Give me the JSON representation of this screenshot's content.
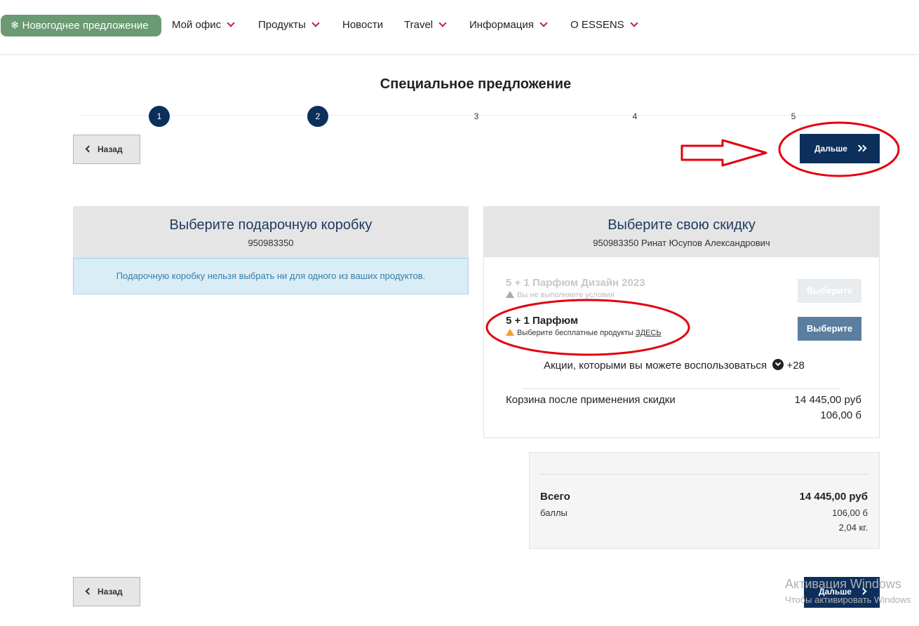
{
  "nav": {
    "promo_label": "Новогоднее предложение",
    "items": [
      "Мой офис",
      "Продукты",
      "Новости",
      "Travel",
      "Информация",
      "O ESSENS"
    ]
  },
  "page": {
    "title": "Специальное предложение"
  },
  "steps": [
    "1",
    "2",
    "3",
    "4",
    "5"
  ],
  "buttons": {
    "back": "Назад",
    "next": "Дальше"
  },
  "gift_box": {
    "title": "Выберите подарочную коробку",
    "id": "950983350",
    "message": "Подарочную коробку нельзя выбрать ни для одного из ваших продуктов."
  },
  "discount": {
    "title": "Выберите свою скидку",
    "subtitle": "950983350 Ринат Юсупов Александрович",
    "promos": [
      {
        "title": "5 + 1 Парфюм Дизайн 2023",
        "note": "Вы не выполняете условия",
        "button": "Выберите"
      },
      {
        "title": "5 + 1 Парфюм",
        "note": "Выберите бесплатные продукты",
        "link": "ЗДЕСЬ",
        "button": "Выберите"
      }
    ],
    "available_label": "Акции, которыми вы можете воспользоваться",
    "available_count": "+28",
    "cart_label": "Корзина после применения скидки",
    "cart_total": "14 445,00 руб",
    "cart_points": "106,00 б"
  },
  "summary": {
    "total_label": "Всего",
    "total_value": "14 445,00 руб",
    "points_label": "баллы",
    "points_value": "106,00 б",
    "weight_value": "2,04 кг."
  },
  "watermark": {
    "line1": "Активация Windows",
    "line2": "Чтобы активировать Windows"
  },
  "colors": {
    "brand_navy": "#0d2f5b",
    "promo_green": "#6a9a72",
    "nav_chevron": "#c2185b",
    "annotation_red": "#e3000f",
    "choose_active": "#5a7ea0",
    "choose_disabled": "#e8ecef"
  }
}
